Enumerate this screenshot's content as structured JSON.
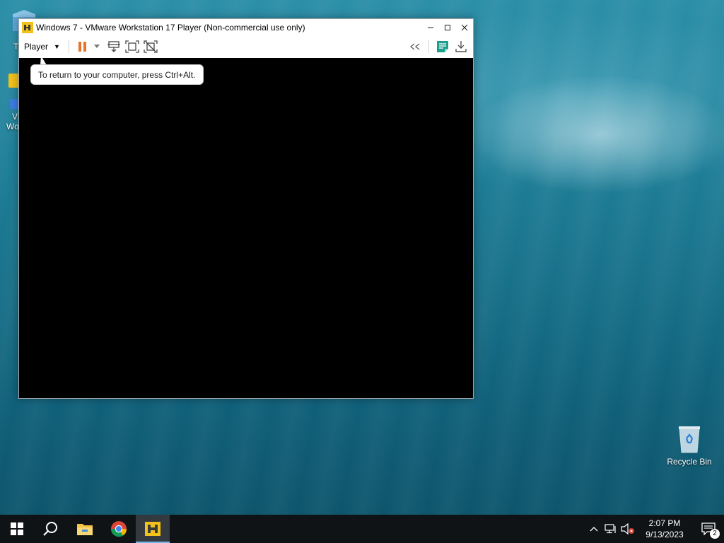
{
  "window": {
    "title": "Windows 7 - VMware Workstation 17 Player (Non-commercial use only)",
    "icon": "vmware-player-icon"
  },
  "toolbar": {
    "player_menu_label": "Player",
    "buttons": [
      "pause-icon",
      "dropdown-caret-icon",
      "send-ctrl-alt-del-icon",
      "full-screen-icon",
      "unity-icon"
    ],
    "right_buttons": [
      "collapse-toolbar-icon",
      "message-log-icon",
      "download-icon"
    ]
  },
  "tooltip": {
    "text": "To return to your computer, press Ctrl+Alt."
  },
  "desktop": {
    "recycle_bin_label": "Recycle Bin",
    "partial_labels": [
      "T",
      "V",
      "Wo"
    ]
  },
  "taskbar": {
    "apps": [
      "start-icon",
      "search-icon",
      "file-explorer-icon",
      "chrome-icon",
      "vmware-player-icon"
    ],
    "active_app": "vmware-player-icon",
    "tray": {
      "time": "2:07 PM",
      "date": "9/13/2023",
      "notification_count": "2"
    }
  },
  "colors": {
    "accent": "#76b9ed",
    "pause_orange": "#e8742a",
    "vmware_yellow": "#f3c21a",
    "toolbar_teal": "#1e9e8c"
  }
}
